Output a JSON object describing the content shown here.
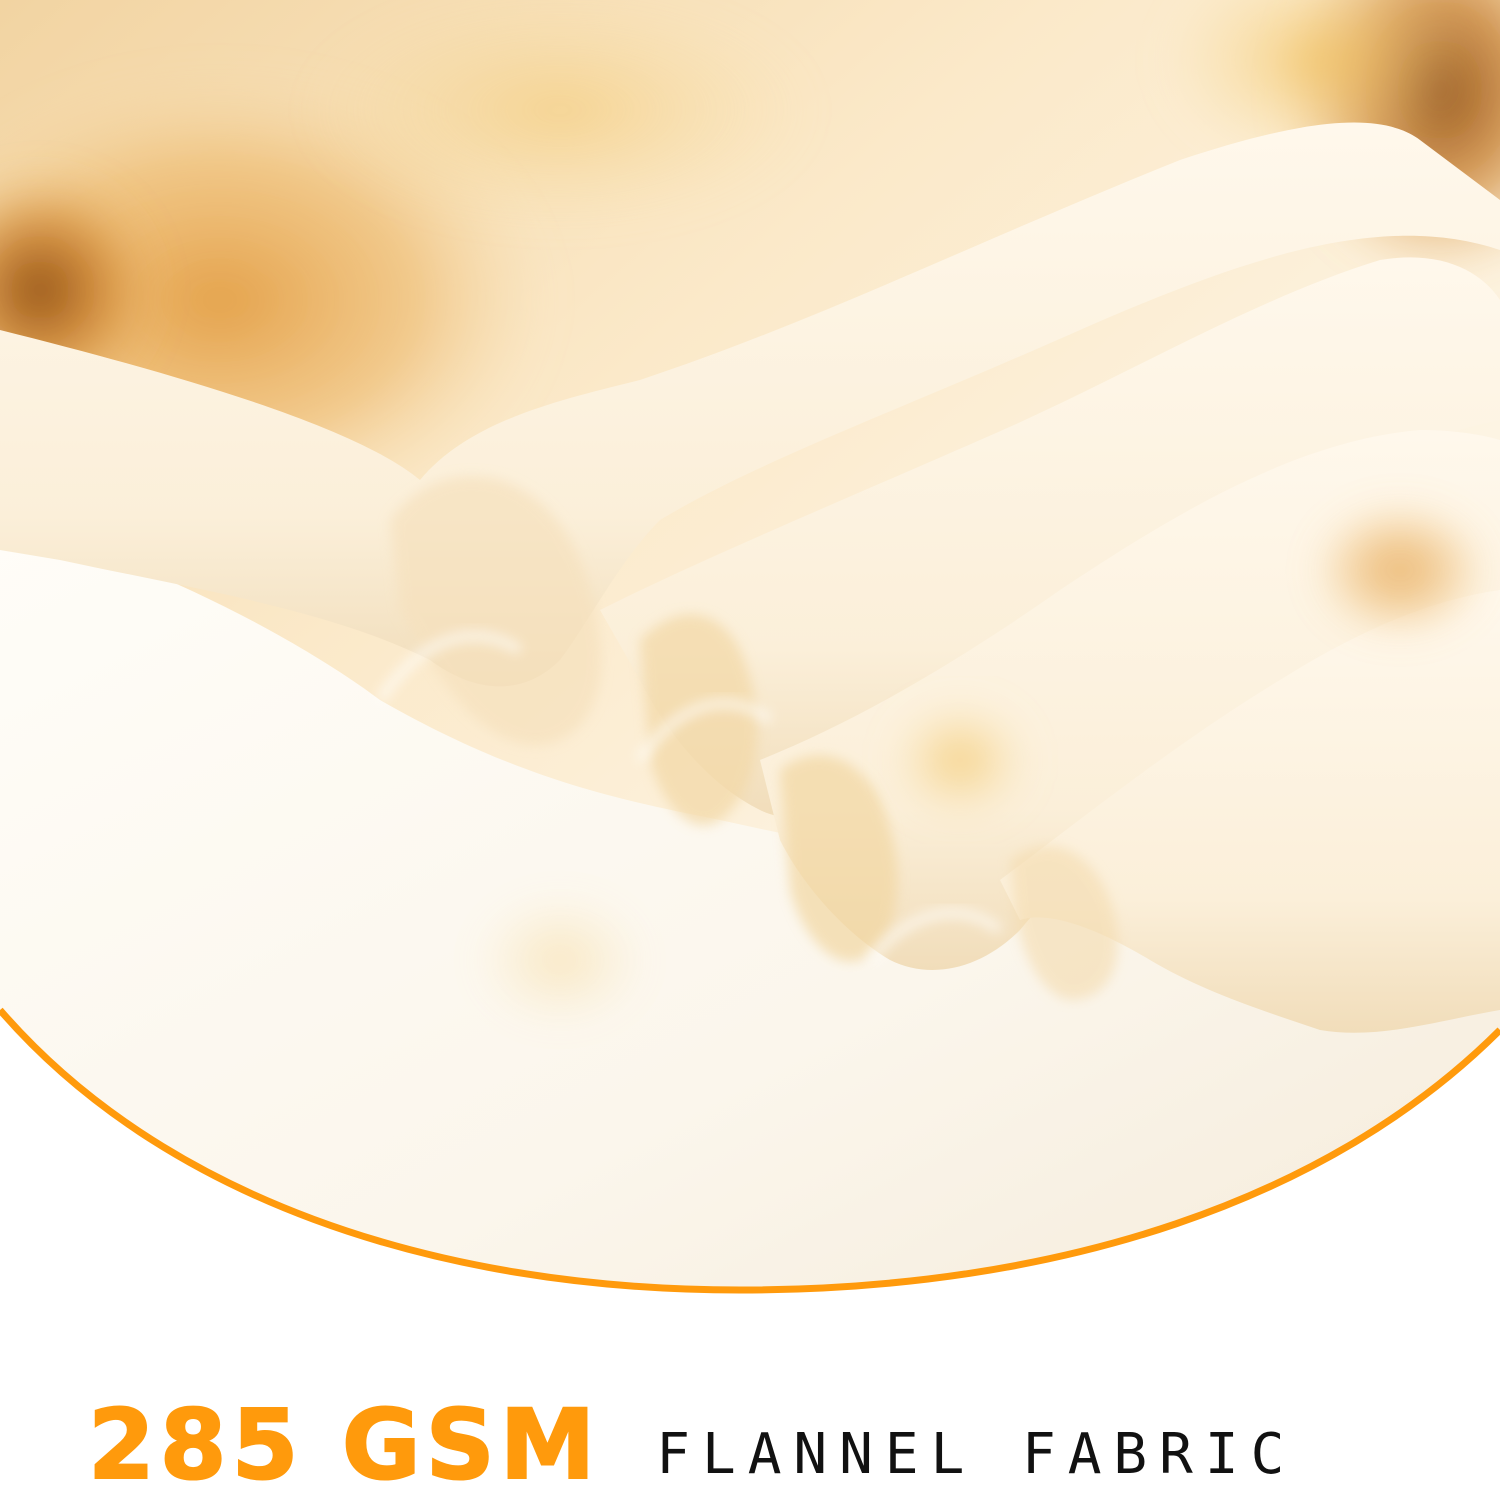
{
  "caption": {
    "weight": "285 GSM",
    "material": "FLANNEL FABRIC"
  },
  "colors": {
    "accent": "#FF9A0C",
    "text_dark": "#111111",
    "fabric_base": "#FBF4E6",
    "fabric_tan": "#E9AF55"
  },
  "image": {
    "subject": "folded-flannel-blanket-photo"
  }
}
